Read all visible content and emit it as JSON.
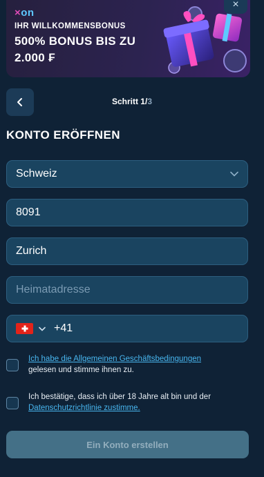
{
  "banner": {
    "logo_x": "×",
    "logo_on": "on",
    "subtitle": "IHR WILLKOMMENSBONUS",
    "headline": "500% BONUS BIS ZU 2.000 ₣",
    "close_label": "×"
  },
  "step": {
    "label": "Schritt 1/",
    "total": "3"
  },
  "form": {
    "title": "KONTO ERÖFFNEN",
    "country": "Schweiz",
    "postal_code": "8091",
    "city": "Zurich",
    "address_placeholder": "Heimatadresse",
    "phone_prefix": "+41",
    "submit_label": "Ein Konto erstellen"
  },
  "consents": {
    "terms": {
      "pre": "Ich habe die ",
      "link": "Allgemeinen Geschäftsbedingungen",
      "post": " gelesen und stimme ihnen zu."
    },
    "age": {
      "pre": "Ich bestätige, dass ich über 18 Jahre alt bin und der ",
      "link": "Datenschutzrichtlinie zustimme.",
      "post": ""
    }
  },
  "colors": {
    "background": "#0f2236",
    "field": "#1a4460",
    "link": "#48b6ef",
    "accent": "#e04bb8"
  },
  "icons": [
    "close-icon",
    "chevron-left-icon",
    "chevron-down-icon",
    "swiss-flag-icon",
    "gift-icon"
  ]
}
